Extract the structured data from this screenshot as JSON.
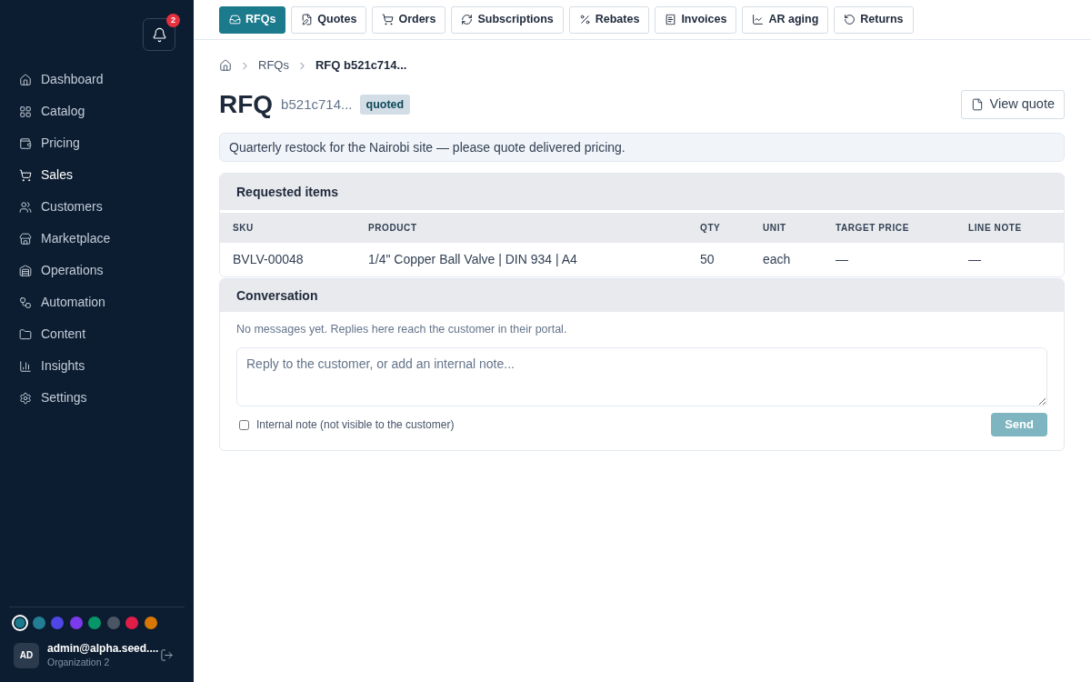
{
  "sidebar": {
    "notifications": {
      "count": "2"
    },
    "nav": [
      {
        "label": "Dashboard",
        "selected": false
      },
      {
        "label": "Catalog",
        "selected": false
      },
      {
        "label": "Pricing",
        "selected": false
      },
      {
        "label": "Sales",
        "selected": true
      },
      {
        "label": "Customers",
        "selected": false
      },
      {
        "label": "Marketplace",
        "selected": false
      },
      {
        "label": "Operations",
        "selected": false
      },
      {
        "label": "Automation",
        "selected": false
      },
      {
        "label": "Content",
        "selected": false
      },
      {
        "label": "Insights",
        "selected": false
      },
      {
        "label": "Settings",
        "selected": false
      }
    ],
    "themes": [
      {
        "color": "#1b7a8c",
        "selected": true
      },
      {
        "color": "#217e94",
        "selected": false
      },
      {
        "color": "#4f46e5",
        "selected": false
      },
      {
        "color": "#7c3aed",
        "selected": false
      },
      {
        "color": "#059669",
        "selected": false
      },
      {
        "color": "#4b5563",
        "selected": false
      },
      {
        "color": "#e11d48",
        "selected": false
      },
      {
        "color": "#d97706",
        "selected": false
      }
    ],
    "user": {
      "initials": "AD",
      "email": "admin@alpha.seed....",
      "org": "Organization 2"
    }
  },
  "tabs": [
    {
      "label": "RFQs",
      "selected": true
    },
    {
      "label": "Quotes",
      "selected": false
    },
    {
      "label": "Orders",
      "selected": false
    },
    {
      "label": "Subscriptions",
      "selected": false
    },
    {
      "label": "Rebates",
      "selected": false
    },
    {
      "label": "Invoices",
      "selected": false
    },
    {
      "label": "AR aging",
      "selected": false
    },
    {
      "label": "Returns",
      "selected": false
    }
  ],
  "breadcrumb": [
    {
      "label": "RFQs",
      "current": false
    },
    {
      "label": "RFQ b521c714...",
      "current": true
    }
  ],
  "header": {
    "title": "RFQ",
    "id": "b521c714...",
    "status": "quoted",
    "action": "View quote"
  },
  "note": "Quarterly restock for the Nairobi site — please quote delivered pricing.",
  "requested_items": {
    "title": "Requested items",
    "columns": [
      "SKU",
      "PRODUCT",
      "QTY",
      "UNIT",
      "TARGET PRICE",
      "LINE NOTE"
    ],
    "rows": [
      [
        "BVLV-00048",
        "1/4\" Copper Ball Valve | DIN 934 | A4",
        "50",
        "each",
        "—",
        "—"
      ]
    ]
  },
  "conversation": {
    "title": "Conversation",
    "empty_text": "No messages yet. Replies here reach the customer in their portal.",
    "reply": {
      "placeholder": "Reply to the customer, or add an internal note..."
    },
    "internal_note": {
      "label": "Internal note (not visible to the customer)",
      "checked": false
    },
    "send": {
      "label": "Send",
      "disabled": true
    }
  }
}
